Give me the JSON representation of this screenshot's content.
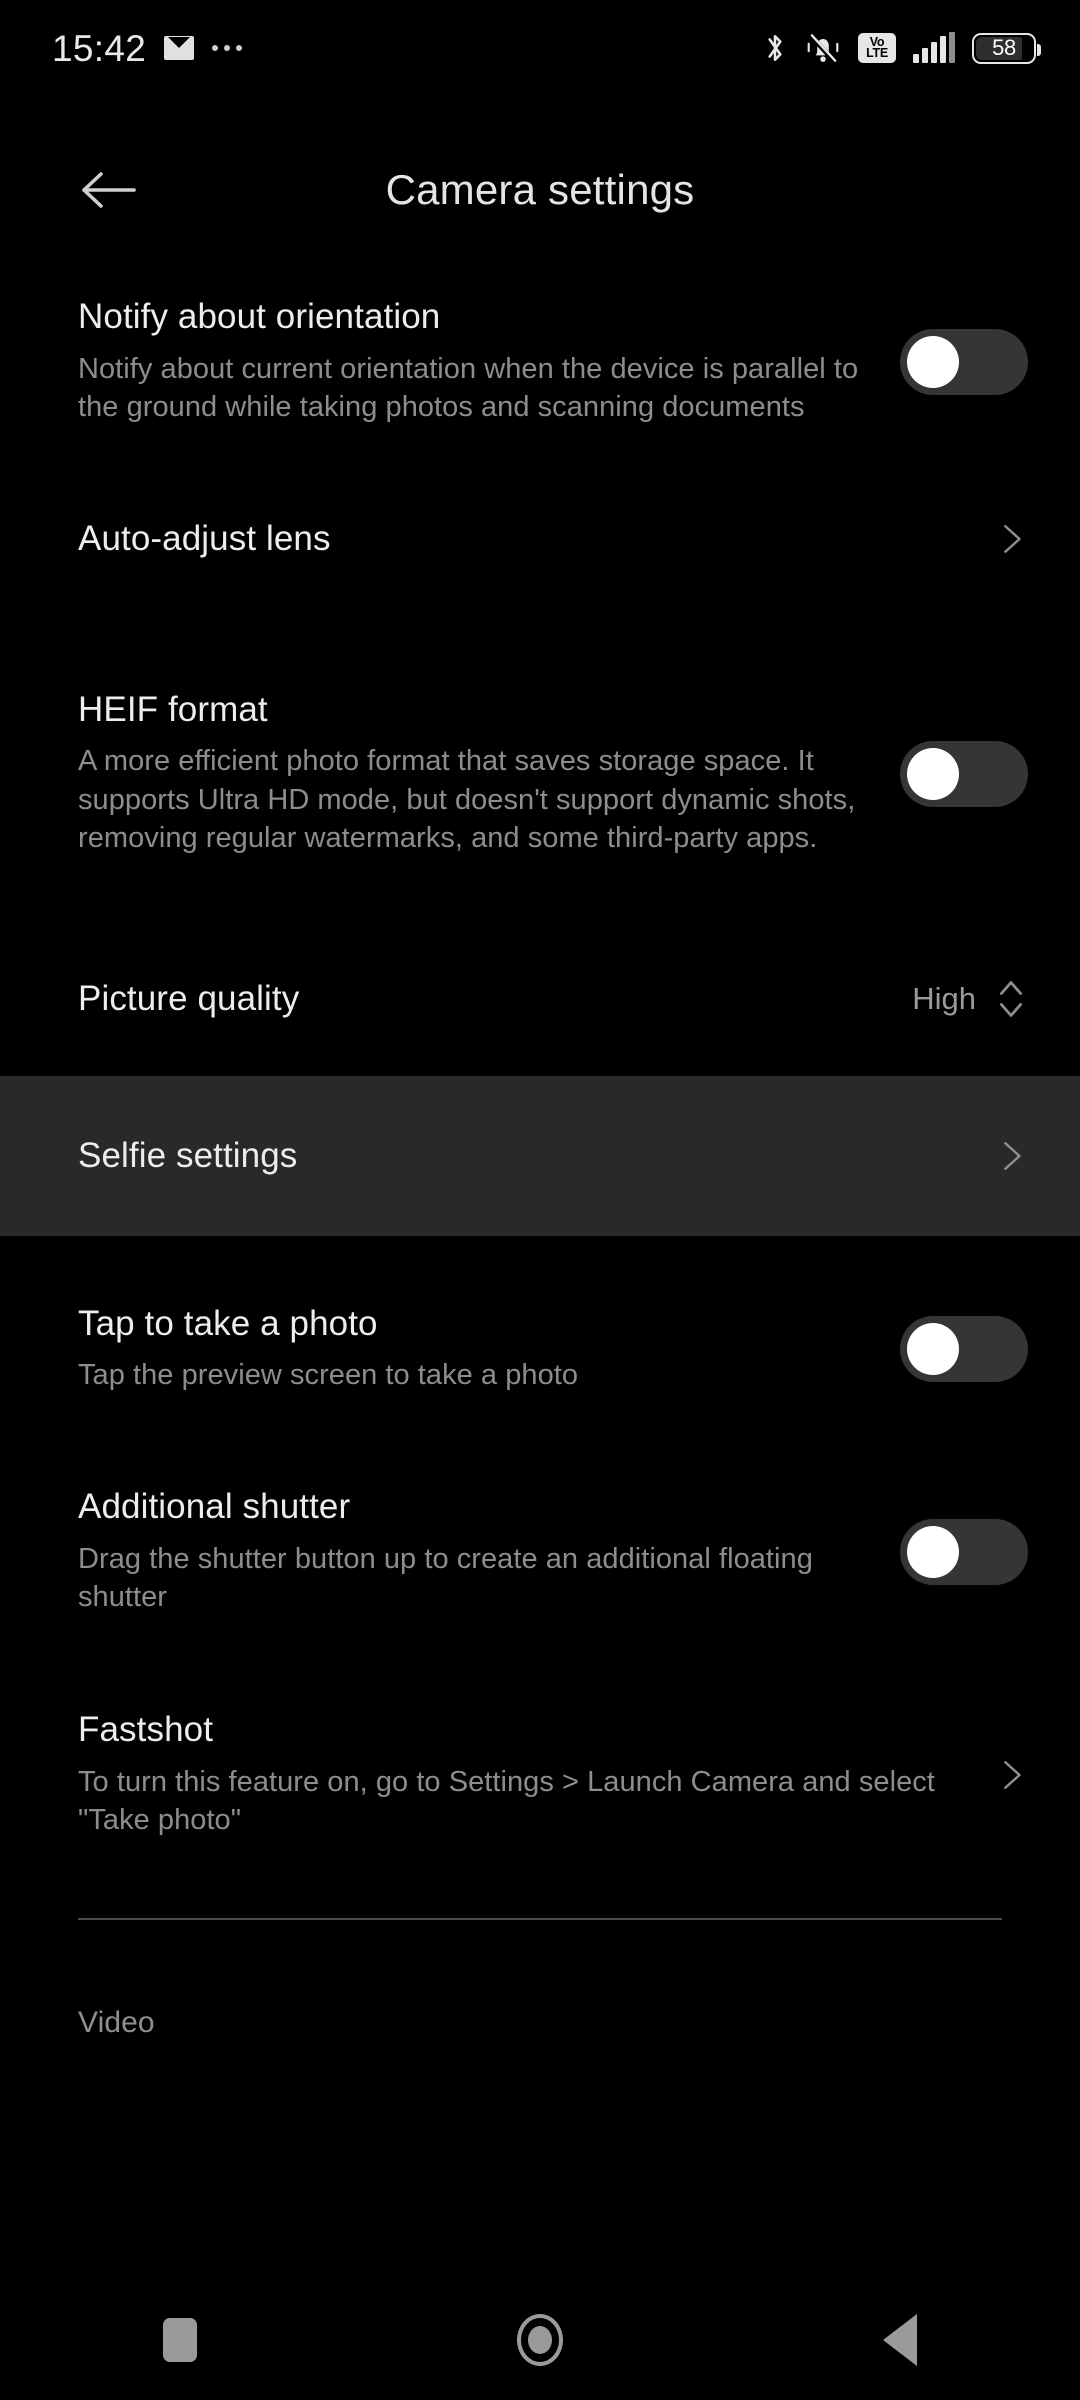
{
  "status_bar": {
    "time": "15:42",
    "mail_icon": "mail-icon",
    "overflow_icon": "more-dots-icon",
    "bluetooth_icon": "bluetooth-icon",
    "silent_icon": "bell-muted-icon",
    "volte_label_top": "Vo",
    "volte_label_bottom": "LTE",
    "signal_icon": "signal-bars-icon",
    "battery_level": "58"
  },
  "app_bar": {
    "back_icon": "arrow-left-icon",
    "title": "Camera settings"
  },
  "colors": {
    "background": "#000000",
    "row_highlight": "#292929",
    "title_text": "#ededed",
    "subtitle_text": "#8d8d8d",
    "toggle_track_off": "#353535",
    "toggle_knob": "#ffffff",
    "divider": "#4a4a4a",
    "nav_icon": "#9a9a9a"
  },
  "settings": {
    "rows": [
      {
        "key": "notify_orientation",
        "title": "Notify about orientation",
        "subtitle": "Notify about current orientation when the device is parallel to the ground while taking photos and scanning documents",
        "control": "toggle",
        "toggle_state": "off"
      },
      {
        "key": "auto_adjust_lens",
        "title": "Auto-adjust lens",
        "subtitle": "",
        "control": "chevron-right"
      },
      {
        "key": "heif_format",
        "title": "HEIF format",
        "subtitle": "A more efficient photo format that saves storage space. It supports Ultra HD mode, but doesn't support dynamic shots, removing regular watermarks, and some third-party apps.",
        "control": "toggle",
        "toggle_state": "off"
      },
      {
        "key": "picture_quality",
        "title": "Picture quality",
        "subtitle": "",
        "control": "stepper",
        "value": "High"
      },
      {
        "key": "selfie_settings",
        "title": "Selfie settings",
        "subtitle": "",
        "control": "chevron-right",
        "highlighted": true
      },
      {
        "key": "tap_to_take_photo",
        "title": "Tap to take a photo",
        "subtitle": "Tap the preview screen to take a photo",
        "control": "toggle",
        "toggle_state": "off"
      },
      {
        "key": "additional_shutter",
        "title": "Additional shutter",
        "subtitle": "Drag the shutter button up to create an additional floating shutter",
        "control": "toggle",
        "toggle_state": "off"
      },
      {
        "key": "fastshot",
        "title": "Fastshot",
        "subtitle": "To turn this feature on, go to Settings > Launch Camera and select \"Take photo\"",
        "control": "chevron-right"
      }
    ],
    "section_header_video": "Video"
  },
  "nav_bar": {
    "recents_icon": "square-recents-icon",
    "home_icon": "circle-home-icon",
    "back_icon": "triangle-back-icon"
  }
}
